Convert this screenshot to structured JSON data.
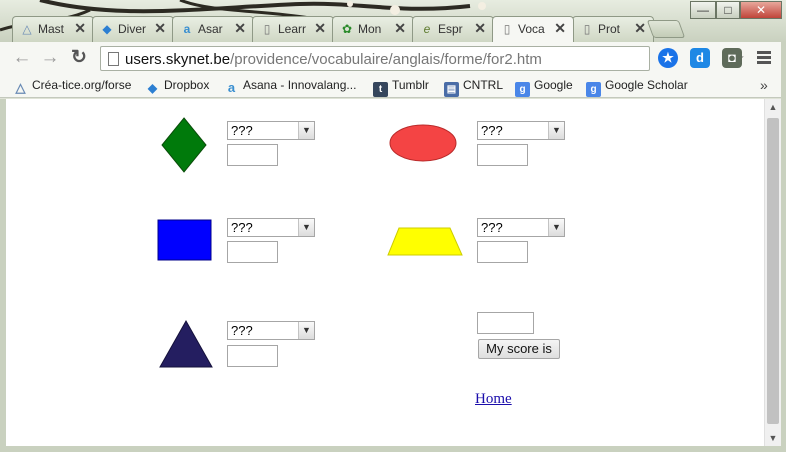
{
  "window": {
    "minimize": "—",
    "maximize": "□",
    "close": "✕"
  },
  "tabs": [
    {
      "label": "Mast",
      "icon": "triangle-logo-icon",
      "close": "✕"
    },
    {
      "label": "Diver",
      "icon": "dropbox-icon",
      "close": "✕"
    },
    {
      "label": "Asar",
      "icon": "asana-icon",
      "close": "✕"
    },
    {
      "label": "Learr",
      "icon": "page-icon",
      "close": "✕"
    },
    {
      "label": "Mon",
      "icon": "flower-icon",
      "close": "✕"
    },
    {
      "label": "Espr",
      "icon": "espresso-icon",
      "close": "✕"
    },
    {
      "label": "Voca",
      "icon": "page-icon",
      "close": "✕",
      "active": true
    },
    {
      "label": "Prot",
      "icon": "page-icon",
      "close": "✕"
    }
  ],
  "toolbar": {
    "back": "←",
    "forward": "→",
    "reload": "↻",
    "url_host": "users.skynet.be",
    "url_path": "/providence/vocabulaire/anglais/forme/for2.htm",
    "star": "☆",
    "ext1": "★",
    "ext2": "d",
    "ext3": "◘"
  },
  "bookmarks": [
    {
      "label": "Créa-tice.org/forse",
      "icon": "triangle-logo-icon",
      "glyph": "△",
      "color": "#6a8bb5"
    },
    {
      "label": "Dropbox",
      "icon": "dropbox-icon",
      "glyph": "◆",
      "color": "#2c7fd2"
    },
    {
      "label": "Asana - Innovalang...",
      "icon": "asana-icon",
      "glyph": "a",
      "color": "#3a8fd0"
    },
    {
      "label": "Tumblr",
      "icon": "tumblr-icon",
      "glyph": "t",
      "color": "#35465c"
    },
    {
      "label": "CNTRL",
      "icon": "cntrl-icon",
      "glyph": "▤",
      "color": "#4a6da7"
    },
    {
      "label": "Google",
      "icon": "google-icon",
      "glyph": "g",
      "color": "#4a86e8"
    },
    {
      "label": "Google Scholar",
      "icon": "scholar-icon",
      "glyph": "g",
      "color": "#4a86e8"
    }
  ],
  "bookmarks_more": "»",
  "quiz": {
    "select_default": "???",
    "select_arrow": "▼",
    "items": [
      {
        "shape": "diamond",
        "color": "#007a0b"
      },
      {
        "shape": "ellipse",
        "color": "#f44444"
      },
      {
        "shape": "rectangle",
        "color": "#0000ff"
      },
      {
        "shape": "trapezoid",
        "color": "#ffff00"
      },
      {
        "shape": "triangle",
        "color": "#241e60"
      }
    ],
    "score_button": "My score is",
    "home_link": "Home"
  },
  "scrollbar": {
    "up": "▲",
    "down": "▼"
  }
}
